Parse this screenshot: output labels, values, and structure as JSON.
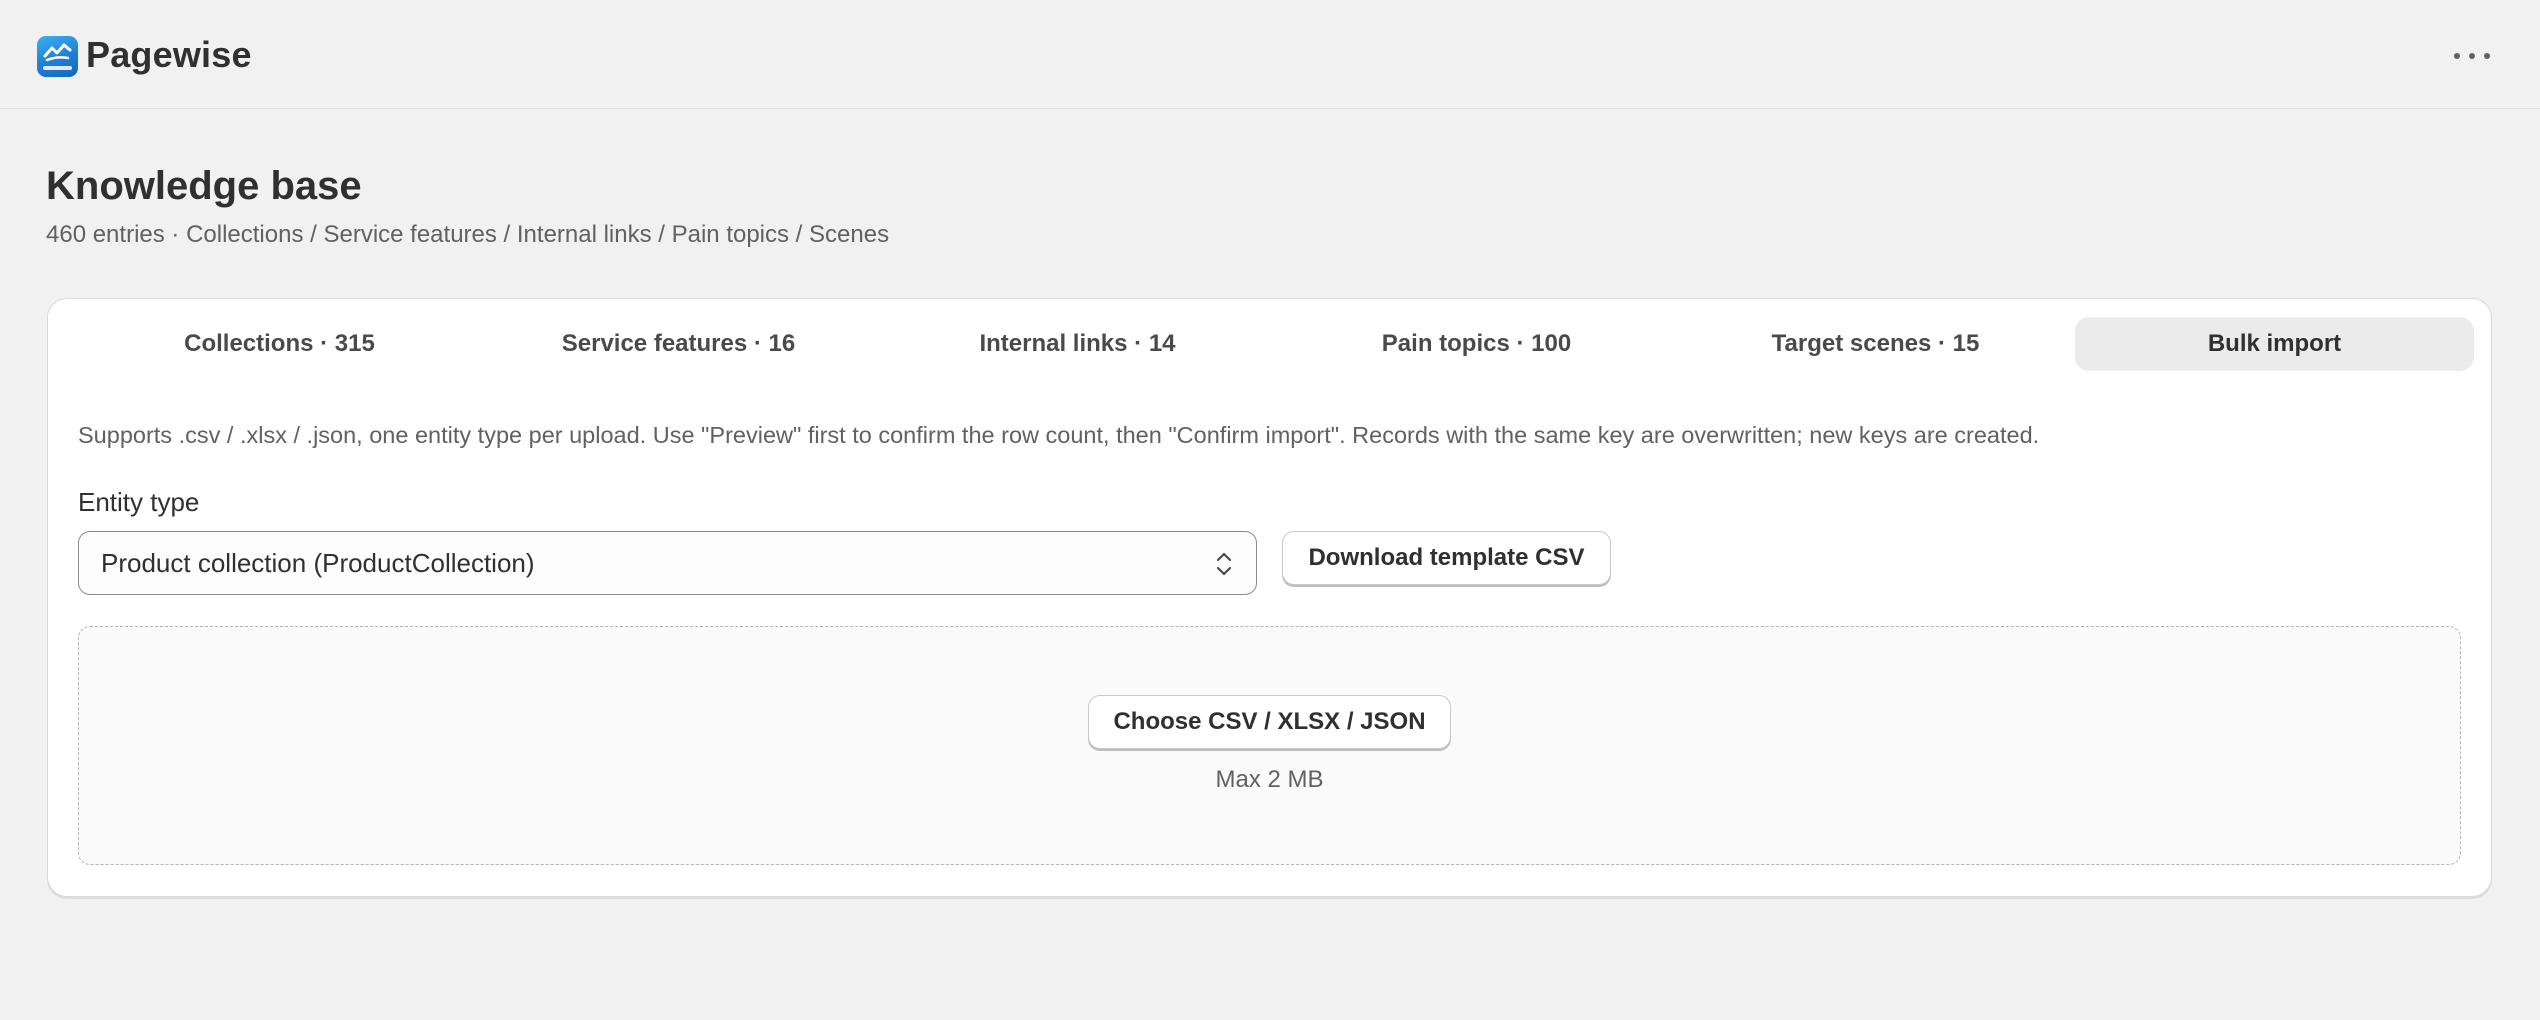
{
  "app": {
    "name": "Pagewise",
    "logo_icon": "pagewise-logo-icon",
    "menu_icon": "more-horizontal-icon"
  },
  "page": {
    "title": "Knowledge base",
    "subtitle": "460 entries · Collections / Service features / Internal links / Pain topics / Scenes"
  },
  "tabs": [
    {
      "label": "Collections · 315",
      "active": false
    },
    {
      "label": "Service features · 16",
      "active": false
    },
    {
      "label": "Internal links · 14",
      "active": false
    },
    {
      "label": "Pain topics · 100",
      "active": false
    },
    {
      "label": "Target scenes · 15",
      "active": false
    },
    {
      "label": "Bulk import",
      "active": true
    }
  ],
  "bulk_import": {
    "help_text": "Supports .csv / .xlsx / .json, one entity type per upload. Use \"Preview\" first to confirm the row count, then \"Confirm import\". Records with the same key are overwritten; new keys are created.",
    "entity_type_label": "Entity type",
    "entity_type_value": "Product collection (ProductCollection)",
    "select_icon": "chevron-up-down-icon",
    "download_template_label": "Download template CSV",
    "choose_file_label": "Choose CSV / XLSX / JSON",
    "max_size_text": "Max 2 MB"
  },
  "colors": {
    "background": "#f1f1f1",
    "card": "#ffffff",
    "active_tab": "#ebebeb",
    "text_primary": "#303030",
    "text_secondary": "#616161",
    "logo_blue": "#1f7fd6"
  }
}
